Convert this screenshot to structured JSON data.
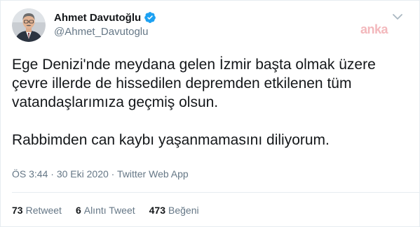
{
  "user": {
    "display_name": "Ahmet Davutoğlu",
    "handle": "@Ahmet_Davutoglu",
    "verified": true,
    "verified_color": "#1da1f2"
  },
  "watermark": "anka",
  "tweet": {
    "paragraph_1": "Ege Denizi'nde meydana gelen İzmir başta olmak üzere çevre illerde de hissedilen depremden etkilenen tüm vatandaşlarımıza geçmiş olsun.",
    "paragraph_2": "Rabbimden can kaybı yaşanmamasını diliyorum."
  },
  "meta": {
    "time": "ÖS 3:44",
    "separator_1": " · ",
    "date": "30 Eki 2020",
    "separator_2": " · ",
    "source": "Twitter Web App"
  },
  "stats": {
    "retweets": {
      "count": "73",
      "label": "Retweet"
    },
    "quotes": {
      "count": "6",
      "label": "Alıntı Tweet"
    },
    "likes": {
      "count": "473",
      "label": "Beğeni"
    }
  },
  "icons": {
    "verified": "verified-badge-icon",
    "more": "chevron-down-icon"
  },
  "colors": {
    "text": "#14171a",
    "secondary": "#657786",
    "border": "#e6ecf0",
    "watermark": "#f3b8bc"
  }
}
